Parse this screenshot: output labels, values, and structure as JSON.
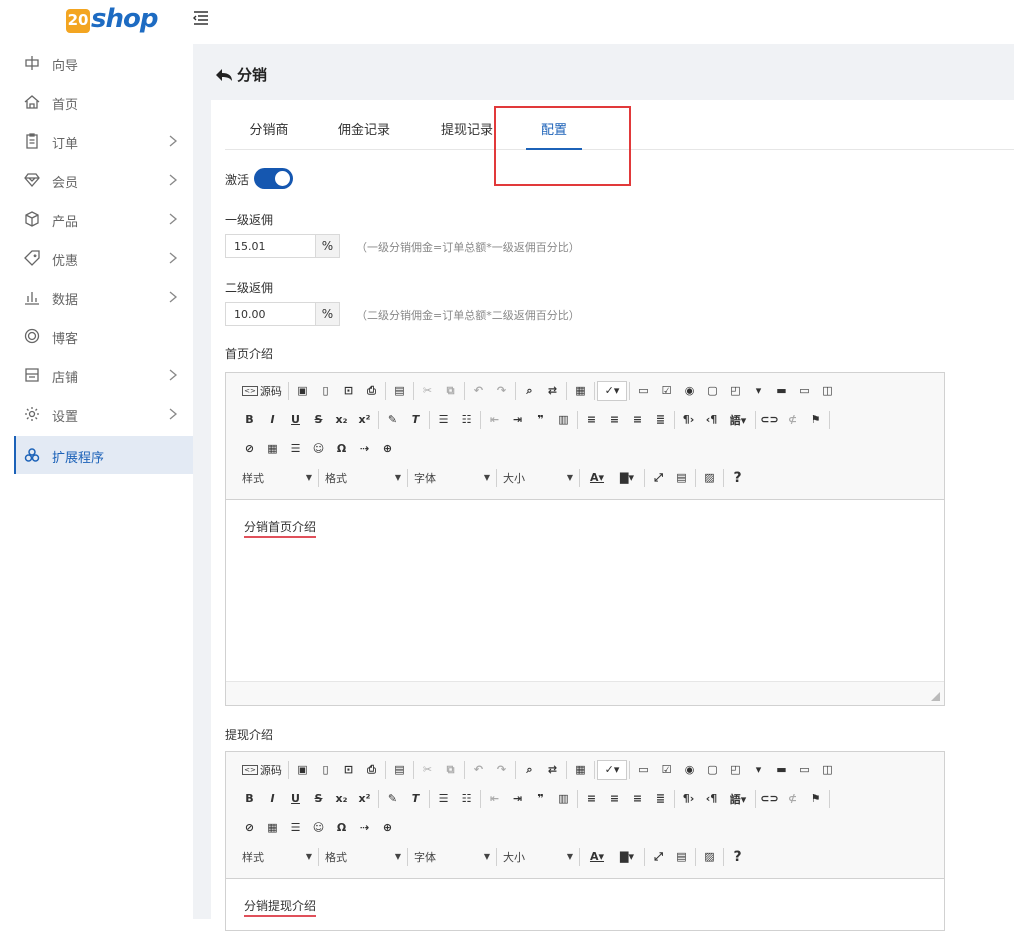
{
  "brand": {
    "logo_num": "20",
    "logo_text": "shop"
  },
  "sidebar": {
    "items": [
      {
        "label": "向导",
        "icon": "guide-icon",
        "chevron": false
      },
      {
        "label": "首页",
        "icon": "home-icon",
        "chevron": false
      },
      {
        "label": "订单",
        "icon": "order-icon",
        "chevron": true
      },
      {
        "label": "会员",
        "icon": "member-icon",
        "chevron": true
      },
      {
        "label": "产品",
        "icon": "product-icon",
        "chevron": true
      },
      {
        "label": "优惠",
        "icon": "coupon-icon",
        "chevron": true
      },
      {
        "label": "数据",
        "icon": "data-icon",
        "chevron": true
      },
      {
        "label": "博客",
        "icon": "blog-icon",
        "chevron": false
      },
      {
        "label": "店铺",
        "icon": "store-icon",
        "chevron": true
      },
      {
        "label": "设置",
        "icon": "settings-icon",
        "chevron": true
      },
      {
        "label": "扩展程序",
        "icon": "extensions-icon",
        "chevron": false,
        "active": true
      }
    ]
  },
  "page": {
    "title": "分销"
  },
  "tabs": [
    {
      "label": "分销商",
      "active": false
    },
    {
      "label": "佣金记录",
      "active": false
    },
    {
      "label": "提现记录",
      "active": false
    },
    {
      "label": "配置",
      "active": true
    }
  ],
  "form": {
    "activate_label": "激活",
    "activate_on": true,
    "level1": {
      "label": "一级返佣",
      "value": "15.01",
      "unit": "%",
      "hint": "（一级分销佣金=订单总额*一级返佣百分比）"
    },
    "level2": {
      "label": "二级返佣",
      "value": "10.00",
      "unit": "%",
      "hint": "（二级分销佣金=订单总额*二级返佣百分比）"
    },
    "home_intro": {
      "label": "首页介绍",
      "content": "分销首页介绍"
    },
    "withdraw_intro": {
      "label": "提现介绍",
      "content": "分销提现介绍"
    }
  },
  "editor": {
    "source_label": "源码",
    "styles_label": "样式",
    "format_label": "格式",
    "font_label": "字体",
    "size_label": "大小"
  },
  "colors": {
    "accent": "#1c62b8",
    "highlight_box": "#e1393a",
    "logo_orange": "#f3a521"
  }
}
